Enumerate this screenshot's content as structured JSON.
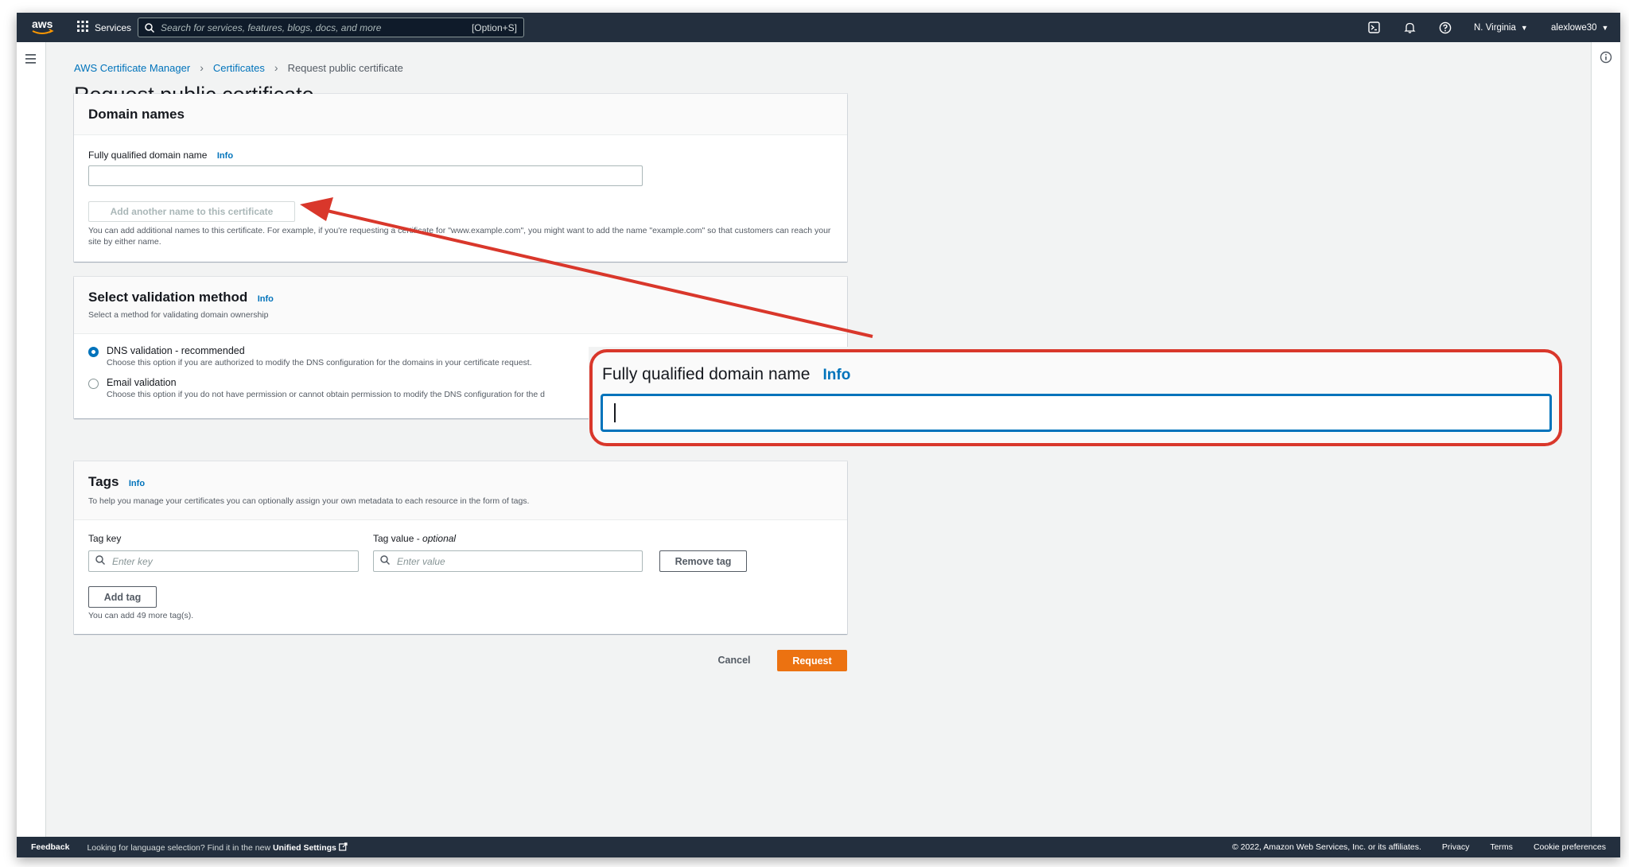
{
  "topnav": {
    "logo_text": "aws",
    "services_label": "Services",
    "search_placeholder": "Search for services, features, blogs, docs, and more",
    "search_shortcut": "[Option+S]",
    "region_label": "N. Virginia",
    "user_label": "alexlowe30"
  },
  "breadcrumb": {
    "items": [
      "AWS Certificate Manager",
      "Certificates"
    ],
    "current": "Request public certificate"
  },
  "page": {
    "title": "Request public certificate"
  },
  "domain_panel": {
    "title": "Domain names",
    "field_label": "Fully qualified domain name",
    "info_label": "Info",
    "field_value": "",
    "add_name_button": "Add another name to this certificate",
    "description": "You can add additional names to this certificate. For example, if you're requesting a certificate for \"www.example.com\", you might want to add the name \"example.com\" so that customers can reach your site by either name."
  },
  "validation_panel": {
    "title": "Select validation method",
    "info_label": "Info",
    "subtitle": "Select a method for validating domain ownership",
    "options": [
      {
        "label": "DNS validation - recommended",
        "description": "Choose this option if you are authorized to modify the DNS configuration for the domains in your certificate request.",
        "selected": true
      },
      {
        "label": "Email validation",
        "description": "Choose this option if you do not have permission or cannot obtain permission to modify the DNS configuration for the d",
        "selected": false
      }
    ]
  },
  "tags_panel": {
    "title": "Tags",
    "info_label": "Info",
    "subtitle": "To help you manage your certificates you can optionally assign your own metadata to each resource in the form of tags.",
    "key_label": "Tag key",
    "value_label": "Tag value - ",
    "value_label_optional": "optional",
    "key_placeholder": "Enter key",
    "value_placeholder": "Enter value",
    "remove_button": "Remove tag",
    "add_button": "Add tag",
    "note": "You can add 49 more tag(s)."
  },
  "actions": {
    "cancel": "Cancel",
    "request": "Request"
  },
  "footer": {
    "feedback": "Feedback",
    "language_text": "Looking for language selection? Find it in the new ",
    "language_link": "Unified Settings",
    "copyright": "© 2022, Amazon Web Services, Inc. or its affiliates.",
    "privacy": "Privacy",
    "terms": "Terms",
    "cookies": "Cookie preferences"
  },
  "callout": {
    "label": "Fully qualified domain name",
    "info_label": "Info",
    "annotation_color": "#d9372b"
  },
  "colors": {
    "nav_bg": "#232f3e",
    "link": "#0073bb",
    "primary_button": "#ec7211",
    "annotation": "#d9372b"
  }
}
